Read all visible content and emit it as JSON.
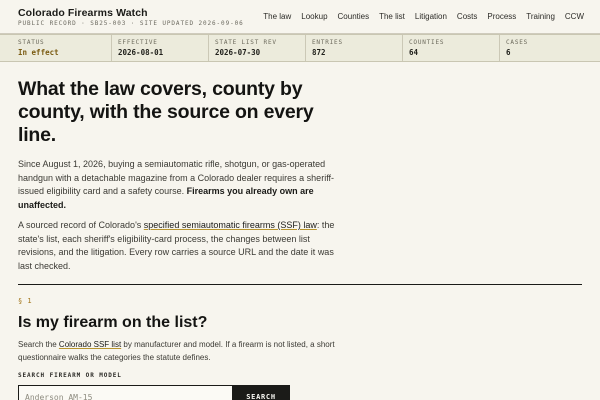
{
  "header": {
    "brand": "Colorado Firearms Watch",
    "subtitle": "PUBLIC RECORD · SB25-003 · SITE UPDATED 2026-09-06",
    "nav": [
      "The law",
      "Lookup",
      "Counties",
      "The list",
      "Litigation",
      "Costs",
      "Process",
      "Training",
      "CCW"
    ]
  },
  "status_strip": [
    {
      "label": "STATUS",
      "value": "In effect"
    },
    {
      "label": "EFFECTIVE",
      "value": "2026-08-01"
    },
    {
      "label": "STATE LIST REV",
      "value": "2026-07-30"
    },
    {
      "label": "ENTRIES",
      "value": "872"
    },
    {
      "label": "COUNTIES",
      "value": "64"
    },
    {
      "label": "CASES",
      "value": "6"
    }
  ],
  "hero": {
    "title": "What the law covers, county by county, with the source on every line.",
    "p1_text": "Since August 1, 2026, buying a semiautomatic rifle, shotgun, or gas-operated handgun with a detachable magazine from a Colorado dealer requires a sheriff-issued eligibility card and a safety course. ",
    "p1_strong": "Firearms you already own are unaffected.",
    "p2_before": "A sourced record of Colorado's ",
    "p2_link": "specified semiautomatic firearms (SSF) law",
    "p2_after": ": the state's list, each sheriff's eligibility-card process, the changes between list revisions, and the litigation. Every row carries a source URL and the date it was last checked."
  },
  "section": {
    "number": "§ 1",
    "title": "Is my firearm on the list?",
    "desc_before": "Search the ",
    "desc_link": "Colorado SSF list",
    "desc_after": " by manufacturer and model. If a firearm is not listed, a short questionnaire walks the categories the statute defines.",
    "search_label": "SEARCH FIREARM OR MODEL",
    "search_placeholder": "Anderson AM-15",
    "search_button": "SEARCH"
  },
  "colors": {
    "background": "#f7f5ee",
    "strip": "#ecebdc",
    "accent": "#a3761b",
    "ink": "#1b1b18"
  }
}
